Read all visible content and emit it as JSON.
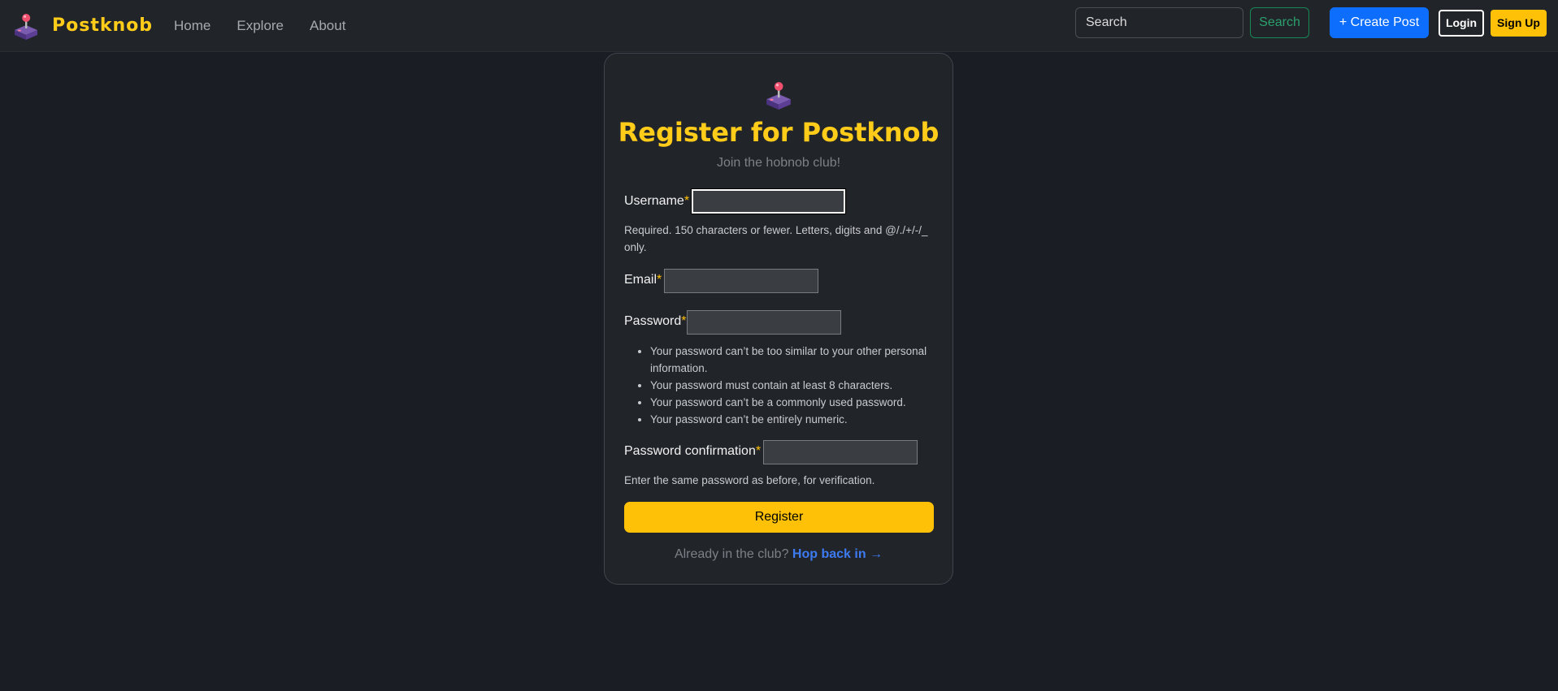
{
  "navbar": {
    "brand": "Postknob",
    "links": [
      "Home",
      "Explore",
      "About"
    ],
    "search_placeholder": "Search",
    "search_button": "Search",
    "create_button": "+ Create Post",
    "login_button": "Login",
    "signup_button": "Sign Up"
  },
  "form": {
    "title": "Register for Postknob",
    "subtitle": "Join the hobnob club!",
    "required_marker": "*",
    "username_label": "Username",
    "username_help": "Required. 150 characters or fewer. Letters, digits and @/./+/-/_ only.",
    "email_label": "Email",
    "password_label": "Password",
    "password_rules": [
      "Your password can’t be too similar to your other personal information.",
      "Your password must contain at least 8 characters.",
      "Your password can’t be a commonly used password.",
      "Your password can’t be entirely numeric."
    ],
    "password_confirmation_label": "Password confirmation",
    "password_confirmation_help": "Enter the same password as before, for verification.",
    "register_button": "Register",
    "footer_text": "Already in the club?",
    "footer_link": "Hop back in →"
  },
  "colors": {
    "brand": "#ffcc1a",
    "background": "#1a1d23",
    "card": "#212429",
    "primary": "#0d6efd",
    "warning": "#ffc107",
    "success": "#198754"
  },
  "icons": {
    "brand": "joystick-icon",
    "card": "joystick-icon"
  }
}
